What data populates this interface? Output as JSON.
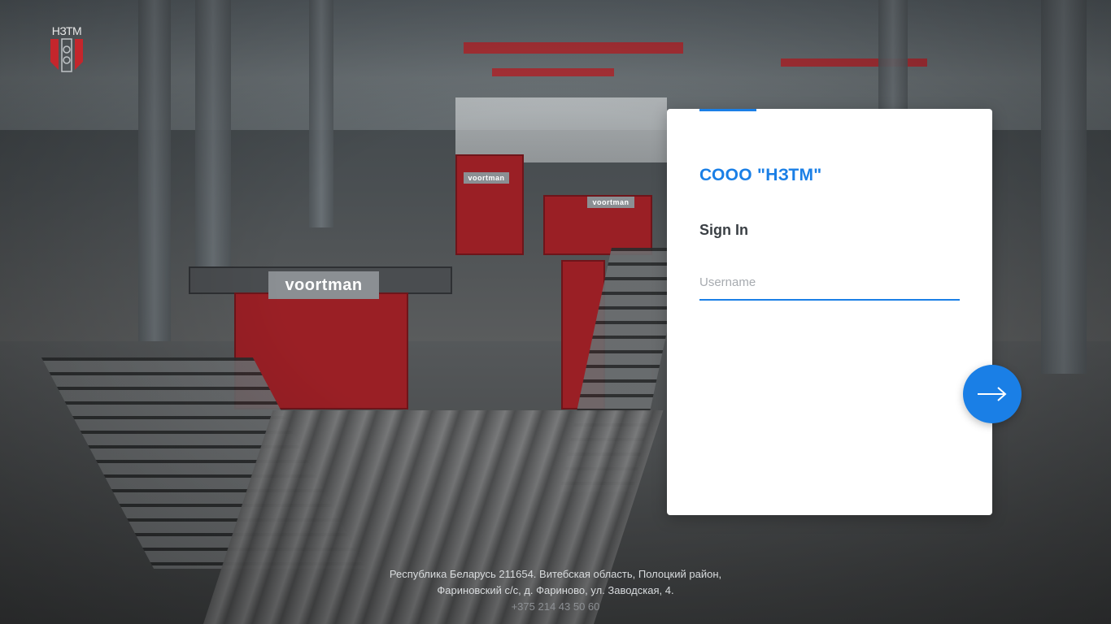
{
  "logo": {
    "text": "НЗТМ",
    "icon": "company-logo-icon"
  },
  "login": {
    "company_name": "СООО \"НЗТМ\"",
    "heading": "Sign In",
    "username_placeholder": "Username",
    "username_value": "",
    "submit_icon": "arrow-right-icon"
  },
  "footer": {
    "address_line1": "Республика Беларусь 211654. Витебская область, Полоцкий район,",
    "address_line2": "Фариновский с/с, д. Фариново, ул. Заводская, 4.",
    "phone": "+375 214 43 50 60"
  },
  "background": {
    "brand_main": "voortman",
    "brand_small_1": "voortman",
    "brand_small_2": "voortman"
  },
  "colors": {
    "accent": "#1a7fe6",
    "heading": "#3a3f44",
    "placeholder": "#a7abb0",
    "logo_red": "#c4262c"
  }
}
